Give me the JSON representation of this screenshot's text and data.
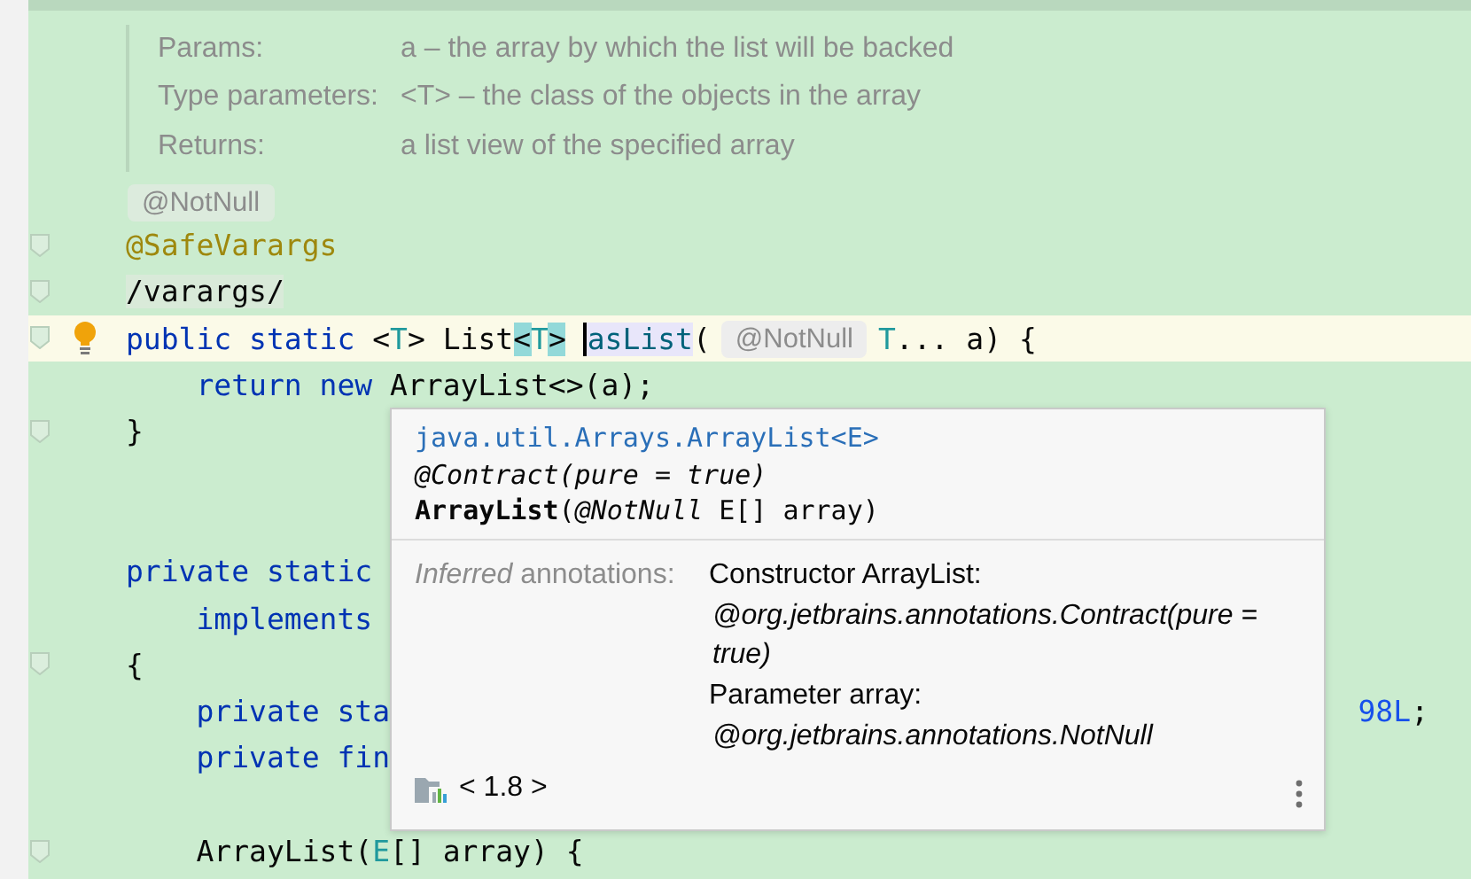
{
  "doc": {
    "rows": [
      {
        "label": "Params:",
        "value": "a – the array by which the list will be backed"
      },
      {
        "label": "Type parameters:",
        "value": "<T> – the class of the objects in the array"
      },
      {
        "label": "Returns:",
        "value": "a list view of the specified array"
      }
    ]
  },
  "inlay_hint": "@NotNull",
  "code_lines": [
    {
      "kind": "fold",
      "tokens": [
        {
          "text": "@SafeVarargs",
          "kind": "annotation"
        }
      ]
    },
    {
      "kind": "fold",
      "tokens": [
        {
          "text": "/varargs/",
          "kind": "comment"
        }
      ]
    },
    {
      "kind": "current",
      "tokens": [
        {
          "text": "public static ",
          "kind": "keyword"
        },
        {
          "text": "<",
          "kind": "plain"
        },
        {
          "text": "T",
          "kind": "typeparam"
        },
        {
          "text": "> List",
          "kind": "plain"
        },
        {
          "text": "<",
          "kind": "brace_match"
        },
        {
          "text": "T",
          "kind": "typeparam"
        },
        {
          "text": ">",
          "kind": "brace_match"
        },
        {
          "text": "asList",
          "kind": "method"
        },
        {
          "text": "(",
          "kind": "plain"
        },
        {
          "text": "@NotNull",
          "kind": "hint"
        },
        {
          "text": "T",
          "kind": "typeparam"
        },
        {
          "text": "... a) {",
          "kind": "plain"
        }
      ]
    },
    {
      "kind": "plain",
      "tokens": [
        {
          "text": "    return new ",
          "kind": "keyword"
        },
        {
          "text": "ArrayList<>(a);",
          "kind": "plain"
        }
      ]
    },
    {
      "kind": "fold",
      "tokens": [
        {
          "text": "}",
          "kind": "plain"
        }
      ]
    },
    {
      "kind": "plain"
    },
    {
      "kind": "plain"
    },
    {
      "kind": "plain",
      "tokens": [
        {
          "text": "private static",
          "kind": "keyword"
        }
      ]
    },
    {
      "kind": "plain",
      "tokens": [
        {
          "text": "    implements",
          "kind": "keyword"
        }
      ]
    },
    {
      "kind": "fold",
      "tokens": [
        {
          "text": "{",
          "kind": "plain"
        }
      ]
    },
    {
      "kind": "plain",
      "tokens": [
        {
          "text": "    private sta",
          "kind": "keyword"
        }
      ],
      "tail": [
        {
          "text": "98L",
          "kind": "number"
        },
        {
          "text": ";",
          "kind": "plain"
        }
      ]
    },
    {
      "kind": "plain",
      "tokens": [
        {
          "text": "    private fin",
          "kind": "keyword"
        }
      ]
    },
    {
      "kind": "plain"
    },
    {
      "kind": "fold",
      "tokens": [
        {
          "text": "    ArrayList(",
          "kind": "plain"
        },
        {
          "text": "E",
          "kind": "typeparam"
        },
        {
          "text": "[] array) {",
          "kind": "plain"
        }
      ]
    }
  ],
  "popup": {
    "class_name": "java.util.Arrays.ArrayList<E>",
    "contract": "@Contract(pure = true)",
    "signature": "**ArrayList**(*@NotNull* E[] array)",
    "label": "*Inferred* annotations:",
    "values": [
      {
        "text": "Constructor ArrayList:",
        "kind": "heading"
      },
      {
        "text": "@org.jetbrains.annotations.Contract(pure = true)",
        "kind": "annotation"
      },
      {
        "text": "Parameter array:",
        "kind": "heading"
      },
      {
        "text": "@org.jetbrains.annotations.NotNull",
        "kind": "annotation"
      }
    ],
    "library": "< 1.8 >"
  }
}
